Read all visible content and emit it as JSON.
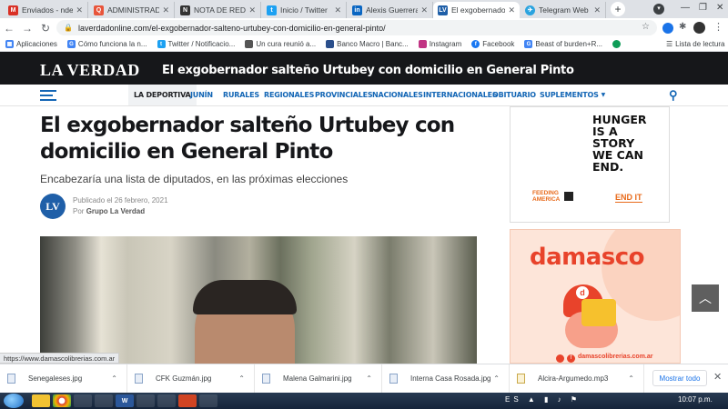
{
  "tabs": [
    {
      "label": "Enviados - ndeem",
      "favicon_text": "M",
      "color": "#d93025"
    },
    {
      "label": "ADMINISTRADOR",
      "favicon_text": "Q",
      "color": "#e8543a"
    },
    {
      "label": "NOTA DE REDACC",
      "favicon_text": "N",
      "color": "#333333"
    },
    {
      "label": "Inicio / Twitter",
      "favicon_text": "t",
      "color": "#1da1f2"
    },
    {
      "label": "Alexis Guerrera a",
      "favicon_text": "in",
      "color": "#0a66c2"
    },
    {
      "label": "El exgobernador s",
      "favicon_text": "LV",
      "color": "#1f5fa8"
    },
    {
      "label": "Telegram Web",
      "favicon_text": "✈",
      "color": "#2aa3df"
    }
  ],
  "new_tab": "+",
  "url": "laverdadonline.com/el-exgobernador-salteno-urtubey-con-domicilio-en-general-pinto/",
  "bookmarks": [
    {
      "label": "Aplicaciones",
      "color": "#5f6368"
    },
    {
      "label": "Cómo funciona la n...",
      "color": "#4285f4"
    },
    {
      "label": "Twitter / Notificacio...",
      "color": "#1da1f2"
    },
    {
      "label": "Un cura reunió a...",
      "color": "#555555"
    },
    {
      "label": "Banco Macro | Banc...",
      "color": "#2b4f8c"
    },
    {
      "label": "Instagram",
      "color": "#c13584"
    },
    {
      "label": "Facebook",
      "color": "#1877f2"
    },
    {
      "label": "Beast of burden+R...",
      "color": "#4285f4"
    }
  ],
  "reading_list": "Lista de lectura",
  "site": {
    "logo": "LA VERDAD",
    "header_title": "El exgobernador salteño Urtubey con domicilio en General Pinto",
    "nav": [
      "LA DEPORTIVA",
      "JUNÍN",
      "RURALES",
      "REGIONALES",
      "PROVINCIALES",
      "NACIONALES",
      "INTERNACIONALES",
      "OBITUARIO",
      "SUPLEMENTOS"
    ]
  },
  "article": {
    "headline": "El exgobernador salteño Urtubey con domicilio en General Pinto",
    "subhead": "Encabezaría una lista de diputados, en las próximas elecciones",
    "author_initials": "LV",
    "published": "Publicado el 26 febrero, 2021",
    "by_prefix": "Por",
    "author": "Grupo La Verdad"
  },
  "ads": {
    "hunger_lines": [
      "HUNGER",
      "IS A",
      "STORY",
      "WE CAN",
      "END."
    ],
    "feeding_america": [
      "FEEDING",
      "AMERICA"
    ],
    "end_it": "END IT",
    "damasco_brand": "damasco",
    "damasco_url": "damascolibrerias.com.ar"
  },
  "status_url": "https://www.damascolibrerias.com.ar",
  "downloads": [
    "Senegaleses.jpg",
    "CFK Guzmán.jpg",
    "Malena Galmarini.jpg",
    "Interna Casa Rosada.jpg",
    "Alcira-Argumedo.mp3"
  ],
  "show_all": "Mostrar todo",
  "system": {
    "lang": "ES",
    "clock": "10:07 p.m."
  }
}
